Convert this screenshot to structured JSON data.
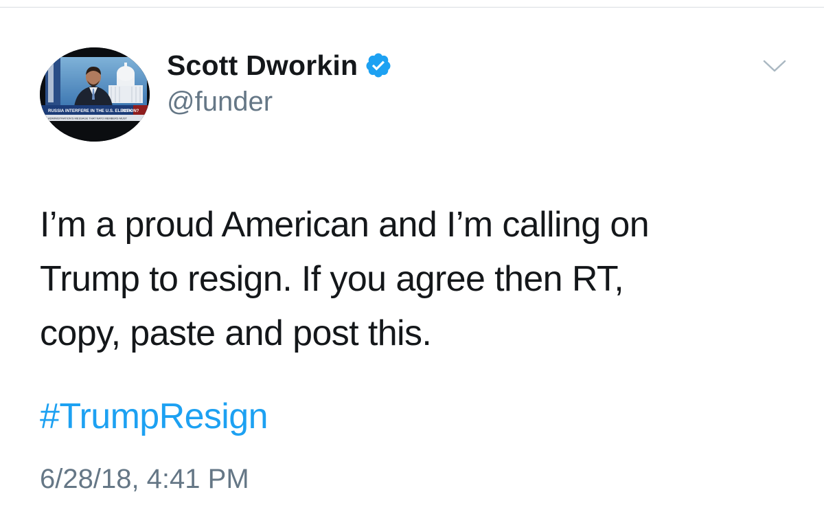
{
  "tweet": {
    "author": {
      "display_name": "Scott Dworkin",
      "handle": "@funder",
      "verified": true,
      "avatar": {
        "banner_text": "RUSSIA INTERFERE IN THE U.S. ELECTION?",
        "ticker_text": "ADMINISTRATION'S MESSAGE THAT NATO MEMBERS MUST",
        "network_logo": "MSN"
      }
    },
    "text_lines": [
      "I’m a proud American and I’m calling on",
      "Trump to resign. If you agree then RT,",
      "copy, paste and post this."
    ],
    "hashtag": "#TrumpResign",
    "timestamp": "6/28/18, 4:41 PM",
    "menu_icon": "chevron-down-icon",
    "verified_icon": "verified-badge-icon"
  },
  "colors": {
    "text": "#14171a",
    "secondary": "#657786",
    "link": "#1da1f2",
    "verified": "#1da1f2",
    "chevron": "#aab8c2"
  }
}
